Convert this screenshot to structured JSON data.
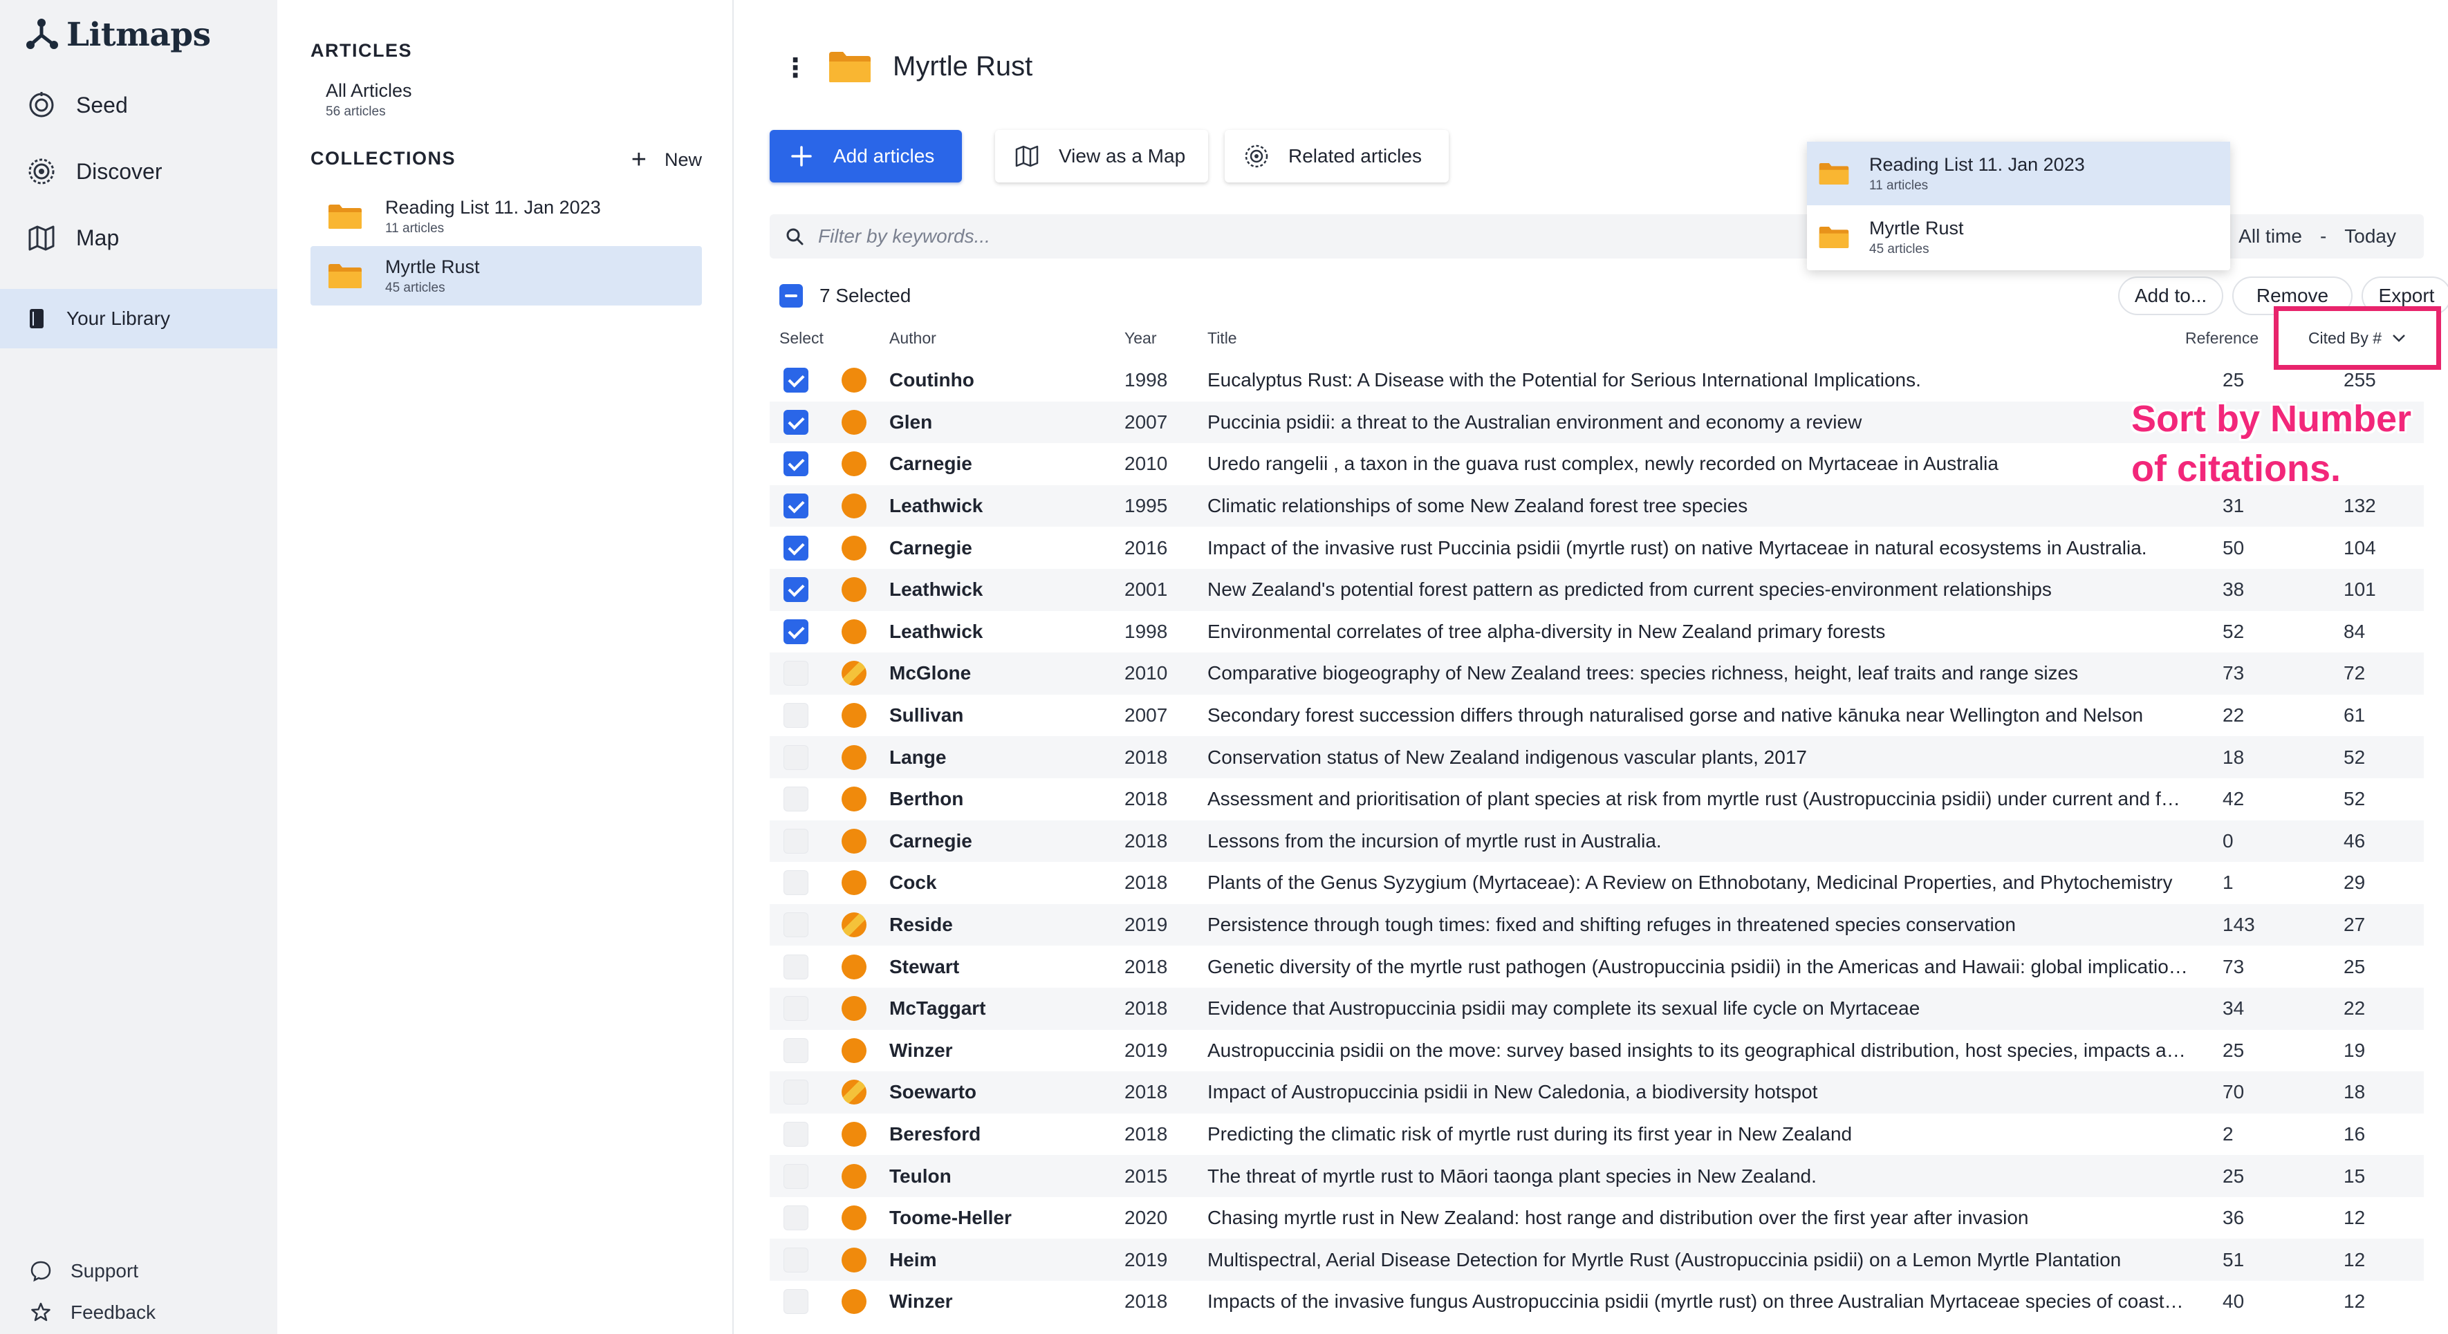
{
  "app": {
    "name": "Litmaps"
  },
  "nav": {
    "items": [
      {
        "label": "Seed",
        "icon": "seed-icon"
      },
      {
        "label": "Discover",
        "icon": "discover-icon"
      },
      {
        "label": "Map",
        "icon": "map-icon"
      }
    ],
    "library": {
      "label": "Your Library",
      "icon": "library-icon"
    },
    "footer": [
      {
        "label": "Support",
        "icon": "chat-icon"
      },
      {
        "label": "Feedback",
        "icon": "star-icon"
      }
    ]
  },
  "library_panel": {
    "articles_heading": "ARTICLES",
    "all_articles": {
      "label": "All Articles",
      "count": "56 articles"
    },
    "collections_heading": "COLLECTIONS",
    "new_label": "New",
    "collections": [
      {
        "name": "Reading List 11. Jan 2023",
        "count": "11 articles",
        "active": false
      },
      {
        "name": "Myrtle Rust",
        "count": "45 articles",
        "active": true
      }
    ]
  },
  "main": {
    "title": "Myrtle Rust",
    "toolbar": {
      "add_articles": "Add articles",
      "view_as_map": "View as a Map",
      "related_articles": "Related articles"
    },
    "filter": {
      "placeholder": "Filter by keywords...",
      "date_from": "All time",
      "date_sep": "-",
      "date_to": "Today"
    },
    "selection": {
      "label": "7 Selected",
      "add_to": "Add to...",
      "remove": "Remove",
      "export": "Export"
    },
    "columns": {
      "select": "Select",
      "author": "Author",
      "year": "Year",
      "title": "Title",
      "reference": "Reference",
      "cited_by": "Cited By #"
    },
    "rows": [
      {
        "selected": true,
        "half": false,
        "author": "Coutinho",
        "year": "1998",
        "title": "Eucalyptus Rust: A Disease with the Potential for Serious International Implications.",
        "ref": "25",
        "cited": "255"
      },
      {
        "selected": true,
        "half": false,
        "author": "Glen",
        "year": "2007",
        "title": "Puccinia psidii: a threat to the Australian environment and economy a review",
        "ref": "",
        "cited": ""
      },
      {
        "selected": true,
        "half": false,
        "author": "Carnegie",
        "year": "2010",
        "title": "Uredo rangelii , a taxon in the guava rust complex, newly recorded on Myrtaceae in Australia",
        "ref": "",
        "cited": ""
      },
      {
        "selected": true,
        "half": false,
        "author": "Leathwick",
        "year": "1995",
        "title": "Climatic relationships of some New Zealand forest tree species",
        "ref": "31",
        "cited": "132"
      },
      {
        "selected": true,
        "half": false,
        "author": "Carnegie",
        "year": "2016",
        "title": "Impact of the invasive rust Puccinia psidii (myrtle rust) on native Myrtaceae in natural ecosystems in Australia.",
        "ref": "50",
        "cited": "104"
      },
      {
        "selected": true,
        "half": false,
        "author": "Leathwick",
        "year": "2001",
        "title": "New Zealand's potential forest pattern as predicted from current species-environment relationships",
        "ref": "38",
        "cited": "101"
      },
      {
        "selected": true,
        "half": false,
        "author": "Leathwick",
        "year": "1998",
        "title": "Environmental correlates of tree alpha-diversity in New Zealand primary forests",
        "ref": "52",
        "cited": "84"
      },
      {
        "selected": false,
        "half": true,
        "author": "McGlone",
        "year": "2010",
        "title": "Comparative biogeography of New Zealand trees: species richness, height, leaf traits and range sizes",
        "ref": "73",
        "cited": "72"
      },
      {
        "selected": false,
        "half": false,
        "author": "Sullivan",
        "year": "2007",
        "title": "Secondary forest succession differs through naturalised gorse and native kānuka near Wellington and Nelson",
        "ref": "22",
        "cited": "61"
      },
      {
        "selected": false,
        "half": false,
        "author": "Lange",
        "year": "2018",
        "title": "Conservation status of New Zealand indigenous vascular plants, 2017",
        "ref": "18",
        "cited": "52"
      },
      {
        "selected": false,
        "half": false,
        "author": "Berthon",
        "year": "2018",
        "title": "Assessment and prioritisation of plant species at risk from myrtle rust (Austropuccinia psidii) under current and future climates",
        "ref": "42",
        "cited": "52"
      },
      {
        "selected": false,
        "half": false,
        "author": "Carnegie",
        "year": "2018",
        "title": "Lessons from the incursion of myrtle rust in Australia.",
        "ref": "0",
        "cited": "46"
      },
      {
        "selected": false,
        "half": false,
        "author": "Cock",
        "year": "2018",
        "title": "Plants of the Genus Syzygium (Myrtaceae): A Review on Ethnobotany, Medicinal Properties, and Phytochemistry",
        "ref": "1",
        "cited": "29"
      },
      {
        "selected": false,
        "half": true,
        "author": "Reside",
        "year": "2019",
        "title": "Persistence through tough times: fixed and shifting refuges in threatened species conservation",
        "ref": "143",
        "cited": "27"
      },
      {
        "selected": false,
        "half": false,
        "author": "Stewart",
        "year": "2018",
        "title": "Genetic diversity of the myrtle rust pathogen (Austropuccinia psidii) in the Americas and Hawaii: global implications for invasive threat assessments",
        "ref": "73",
        "cited": "25"
      },
      {
        "selected": false,
        "half": false,
        "author": "McTaggart",
        "year": "2018",
        "title": "Evidence that Austropuccinia psidii may complete its sexual life cycle on Myrtaceae",
        "ref": "34",
        "cited": "22"
      },
      {
        "selected": false,
        "half": false,
        "author": "Winzer",
        "year": "2019",
        "title": "Austropuccinia psidii on the move: survey based insights to its geographical distribution, host species, impacts and management in Australia",
        "ref": "25",
        "cited": "19"
      },
      {
        "selected": false,
        "half": true,
        "author": "Soewarto",
        "year": "2018",
        "title": "Impact of Austropuccinia psidii in New Caledonia, a biodiversity hotspot",
        "ref": "70",
        "cited": "18"
      },
      {
        "selected": false,
        "half": false,
        "author": "Beresford",
        "year": "2018",
        "title": "Predicting the climatic risk of myrtle rust during its first year in New Zealand",
        "ref": "2",
        "cited": "16"
      },
      {
        "selected": false,
        "half": false,
        "author": "Teulon",
        "year": "2015",
        "title": "The threat of myrtle rust to Māori taonga plant species in New Zealand.",
        "ref": "25",
        "cited": "15"
      },
      {
        "selected": false,
        "half": false,
        "author": "Toome-Heller",
        "year": "2020",
        "title": "Chasing myrtle rust in New Zealand: host range and distribution over the first year after invasion",
        "ref": "36",
        "cited": "12"
      },
      {
        "selected": false,
        "half": false,
        "author": "Heim",
        "year": "2019",
        "title": "Multispectral, Aerial Disease Detection for Myrtle Rust (Austropuccinia psidii) on a Lemon Myrtle Plantation",
        "ref": "51",
        "cited": "12"
      },
      {
        "selected": false,
        "half": false,
        "author": "Winzer",
        "year": "2018",
        "title": "Impacts of the invasive fungus Austropuccinia psidii (myrtle rust) on three Australian Myrtaceae species of coastal swamp woodland",
        "ref": "40",
        "cited": "12"
      }
    ]
  },
  "dropdown": {
    "items": [
      {
        "name": "Reading List 11. Jan 2023",
        "count": "11 articles"
      },
      {
        "name": "Myrtle Rust",
        "count": "45 articles"
      }
    ]
  },
  "annotation": {
    "line1": "Sort by Number",
    "line2": "of citations."
  },
  "colors": {
    "accent": "#2a66e8",
    "folder": "#f6a21e",
    "highlight": "#e8246c",
    "dot": "#f08a0c"
  }
}
